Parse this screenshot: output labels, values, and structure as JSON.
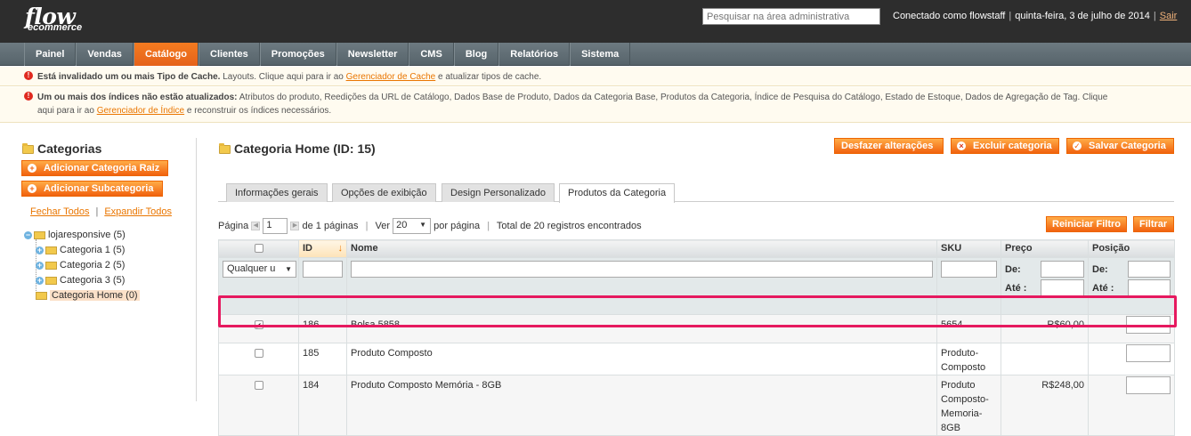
{
  "header": {
    "logo_line1": "flow",
    "logo_line2": "ecommerce",
    "search_placeholder": "Pesquisar na área administrativa",
    "user_text": "Conectado como flowstaff",
    "date_text": "quinta-feira, 3 de julho de 2014",
    "logout_label": "Sair"
  },
  "nav": {
    "items": [
      {
        "label": "Painel"
      },
      {
        "label": "Vendas"
      },
      {
        "label": "Catálogo"
      },
      {
        "label": "Clientes"
      },
      {
        "label": "Promoções"
      },
      {
        "label": "Newsletter"
      },
      {
        "label": "CMS"
      },
      {
        "label": "Blog"
      },
      {
        "label": "Relatórios"
      },
      {
        "label": "Sistema"
      }
    ]
  },
  "messages": {
    "cache": {
      "bold": "Está invalidado um ou mais Tipo de Cache.",
      "text": " Layouts. Clique aqui para ir ao ",
      "link": "Gerenciador de Cache",
      "after": " e atualizar tipos de cache."
    },
    "index": {
      "bold": "Um ou mais dos índices não estão atualizados:",
      "text": " Atributos do produto, Reedições da URL de Catálogo, Dados Base de Produto, Dados da Categoria Base, Produtos da Categoria, Índice de Pesquisa do Catálogo, Estado de Estoque, Dados de Agregação de Tag. Clique",
      "text2": "aqui para ir ao ",
      "link": "Gerenciador de Índice",
      "after": " e reconstruir os índices necessários."
    }
  },
  "sidebar": {
    "title": "Categorias",
    "add_root_label": "Adicionar Categoria Raiz",
    "add_sub_label": "Adicionar Subcategoria",
    "collapse_label": "Fechar Todos",
    "expand_label": "Expandir Todos",
    "tree": [
      {
        "label": "lojaresponsive (5)"
      },
      {
        "label": "Categoria 1 (5)"
      },
      {
        "label": "Categoria 2 (5)"
      },
      {
        "label": "Categoria 3 (5)"
      },
      {
        "label": "Categoria Home (0)"
      }
    ]
  },
  "main": {
    "title": "Categoria Home (ID: 15)",
    "reset_label": "Desfazer alterações",
    "delete_label": "Excluir categoria",
    "save_label": "Salvar Categoria",
    "tabs": [
      {
        "label": "Informações gerais"
      },
      {
        "label": "Opções de exibição"
      },
      {
        "label": "Design Personalizado"
      },
      {
        "label": "Produtos da Categoria"
      }
    ],
    "pager": {
      "page_label": "Página",
      "page_value": "1",
      "of_pages": "de 1 páginas",
      "view_label": "Ver",
      "per_page": "20",
      "per_page_label": "por página",
      "total": "Total de 20 registros encontrados"
    },
    "reset_filter_label": "Reiniciar Filtro",
    "filter_label": "Filtrar"
  },
  "grid": {
    "headers": {
      "id": "ID",
      "name": "Nome",
      "sku": "SKU",
      "price": "Preço",
      "position": "Posição"
    },
    "filter_select": "Qualquer u",
    "from_label": "De:",
    "to_label": "Até :",
    "rows": [
      {
        "id": "186",
        "name": "Bolsa 5858",
        "sku": "5654",
        "price": "R$60,00"
      },
      {
        "id": "185",
        "name": "Produto Composto",
        "sku": "Produto-Composto",
        "price": ""
      },
      {
        "id": "184",
        "name": "Produto Composto Memória - 8GB",
        "sku": "Produto Composto-Memoria-8GB",
        "price": "R$248,00"
      }
    ]
  },
  "colors": {
    "accent": "#eb5e00",
    "highlight": "#e6195f",
    "header_bg": "#2d2d2d"
  }
}
